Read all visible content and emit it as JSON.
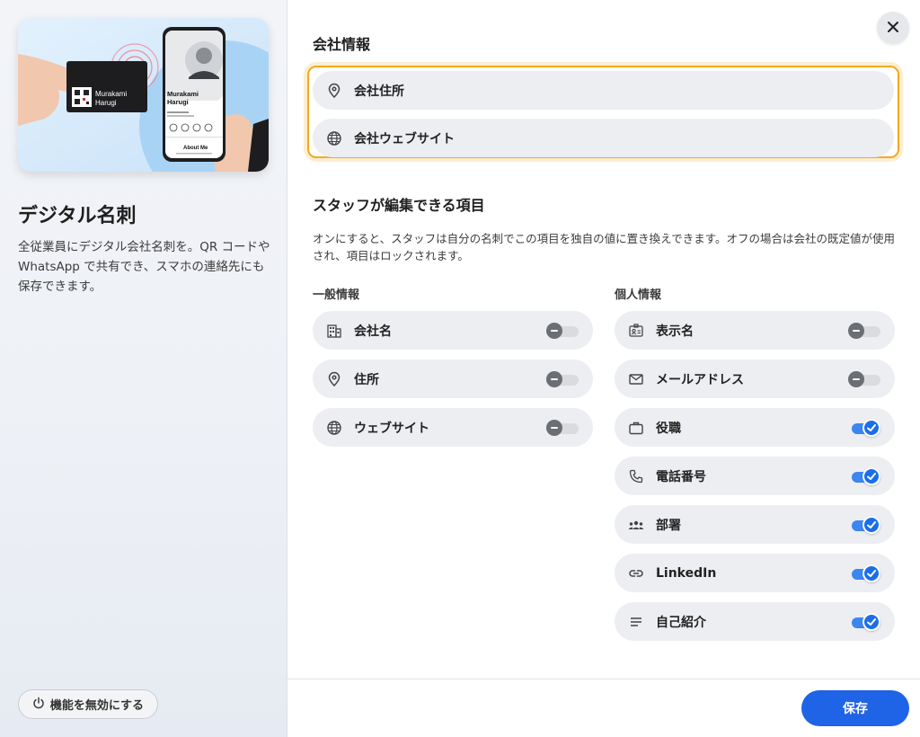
{
  "left": {
    "card_name_line1": "Murakami",
    "card_name_line2": "Harugi",
    "phone_name_line1": "Murakami",
    "phone_name_line2": "Harugi",
    "phone_about": "About Me",
    "title": "デジタル名刺",
    "description": "全従業員にデジタル会社名刺を。QR コードや WhatsApp で共有でき、スマホの連絡先にも保存できます。",
    "disable_button": "機能を無効にする"
  },
  "company": {
    "heading": "会社情報",
    "address_placeholder": "会社住所",
    "website_placeholder": "会社ウェブサイト"
  },
  "editable": {
    "heading": "スタッフが編集できる項目",
    "description": "オンにすると、スタッフは自分の名刺でこの項目を独自の値に置き換えできます。オフの場合は会社の既定値が使用され、項目はロックされます。",
    "general_label": "一般情報",
    "personal_label": "個人情報",
    "general": [
      {
        "label": "会社名",
        "icon": "building-icon",
        "on": false
      },
      {
        "label": "住所",
        "icon": "location-pin-icon",
        "on": false
      },
      {
        "label": "ウェブサイト",
        "icon": "globe-icon",
        "on": false
      }
    ],
    "personal": [
      {
        "label": "表示名",
        "icon": "id-badge-icon",
        "on": false
      },
      {
        "label": "メールアドレス",
        "icon": "mail-icon",
        "on": false
      },
      {
        "label": "役職",
        "icon": "briefcase-icon",
        "on": true
      },
      {
        "label": "電話番号",
        "icon": "phone-icon",
        "on": true
      },
      {
        "label": "部署",
        "icon": "group-icon",
        "on": true
      },
      {
        "label": "LinkedIn",
        "icon": "link-icon",
        "on": true
      },
      {
        "label": "自己紹介",
        "icon": "text-lines-icon",
        "on": true
      }
    ]
  },
  "footer": {
    "save_label": "保存"
  },
  "colors": {
    "accent": "#1f63e6",
    "highlight": "#f2a91f",
    "toggle_on": "#1c6ee8",
    "toggle_off": "#6b6e73"
  }
}
